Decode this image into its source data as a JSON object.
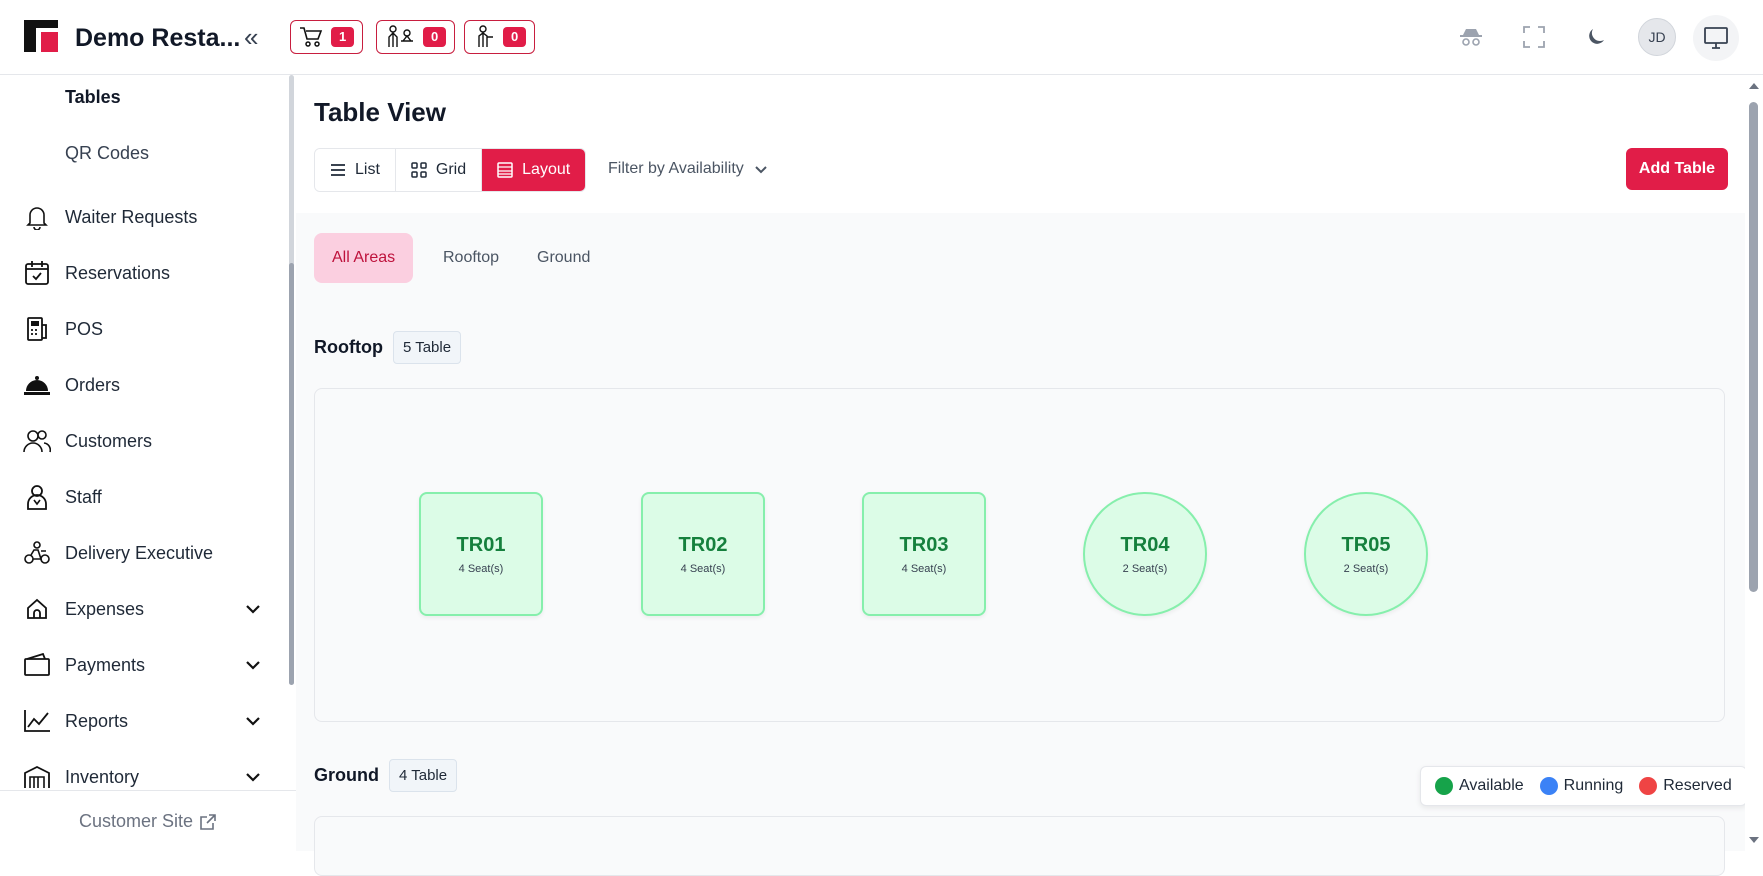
{
  "header": {
    "app_title": "Demo Resta...",
    "badges": [
      {
        "icon": "cart-icon",
        "count": "1"
      },
      {
        "icon": "waiter-request-icon",
        "count": "0"
      },
      {
        "icon": "waiter-icon",
        "count": "0"
      }
    ],
    "avatar_initials": "JD"
  },
  "sidebar": {
    "sub_items": [
      "Tables",
      "QR Codes"
    ],
    "items": [
      {
        "label": "Waiter Requests",
        "icon": "bell-icon"
      },
      {
        "label": "Reservations",
        "icon": "calendar-check-icon"
      },
      {
        "label": "POS",
        "icon": "pos-terminal-icon"
      },
      {
        "label": "Orders",
        "icon": "cloche-icon"
      },
      {
        "label": "Customers",
        "icon": "users-icon"
      },
      {
        "label": "Staff",
        "icon": "staff-icon"
      },
      {
        "label": "Delivery Executive",
        "icon": "scooter-icon"
      },
      {
        "label": "Expenses",
        "icon": "home-icon"
      },
      {
        "label": "Payments",
        "icon": "wallet-icon"
      },
      {
        "label": "Reports",
        "icon": "chart-line-icon"
      },
      {
        "label": "Inventory",
        "icon": "warehouse-icon"
      }
    ],
    "footer_link": "Customer Site"
  },
  "main": {
    "page_title": "Table View",
    "views": [
      "List",
      "Grid",
      "Layout"
    ],
    "active_view": "Layout",
    "filter_label": "Filter by Availability",
    "add_button": "Add Table",
    "area_tabs": [
      "All Areas",
      "Rooftop",
      "Ground"
    ],
    "active_area": "All Areas",
    "sections": [
      {
        "name": "Rooftop",
        "count_label": "5 Table",
        "tables": [
          {
            "code": "TR01",
            "seats": "4 Seat(s)",
            "shape": "square"
          },
          {
            "code": "TR02",
            "seats": "4 Seat(s)",
            "shape": "square"
          },
          {
            "code": "TR03",
            "seats": "4 Seat(s)",
            "shape": "square"
          },
          {
            "code": "TR04",
            "seats": "2 Seat(s)",
            "shape": "round"
          },
          {
            "code": "TR05",
            "seats": "2 Seat(s)",
            "shape": "round"
          }
        ]
      },
      {
        "name": "Ground",
        "count_label": "4 Table",
        "tables": []
      }
    ],
    "legend": [
      {
        "label": "Available",
        "color": "#16a34a"
      },
      {
        "label": "Running",
        "color": "#3b82f6"
      },
      {
        "label": "Reserved",
        "color": "#ef4444"
      }
    ]
  },
  "colors": {
    "accent": "#e11d48",
    "table_fill": "#dcfce7",
    "table_text": "#15803d"
  }
}
